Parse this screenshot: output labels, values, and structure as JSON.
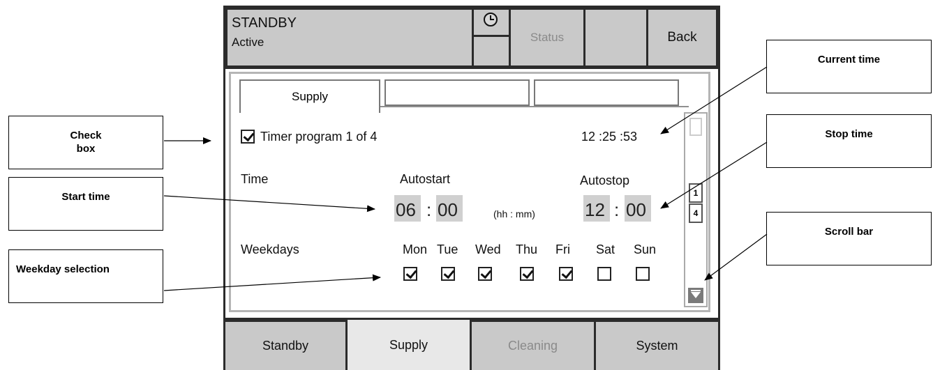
{
  "header": {
    "title": "STANDBY",
    "subtitle": "Active",
    "status_label": "Status",
    "back_label": "Back"
  },
  "tabs": [
    {
      "label": "Supply",
      "active": true
    },
    {
      "label": "",
      "active": false
    },
    {
      "label": "",
      "active": false
    }
  ],
  "content": {
    "timer_program_label": "Timer program 1 of 4",
    "timer_program_checked": true,
    "current_time": "12 :25 :53",
    "time_label": "Time",
    "autostart_label": "Autostart",
    "autostop_label": "Autostop",
    "start_hh": "06",
    "start_mm": "00",
    "stop_hh": "12",
    "stop_mm": "00",
    "colon": ":",
    "format_hint": "(hh : mm)",
    "weekdays_label": "Weekdays",
    "days": [
      {
        "label": "Mon",
        "checked": true
      },
      {
        "label": "Tue",
        "checked": true
      },
      {
        "label": "Wed",
        "checked": true
      },
      {
        "label": "Thu",
        "checked": true
      },
      {
        "label": "Fri",
        "checked": true
      },
      {
        "label": "Sat",
        "checked": false
      },
      {
        "label": "Sun",
        "checked": false
      }
    ]
  },
  "scrollbar": {
    "page_current": "1",
    "page_total": "4",
    "arrow_icon": "scroll-down-arrow-icon"
  },
  "footer_tabs": [
    {
      "label": "Standby",
      "state": "normal"
    },
    {
      "label": "Supply",
      "state": "active"
    },
    {
      "label": "Cleaning",
      "state": "disabled"
    },
    {
      "label": "System",
      "state": "normal"
    }
  ],
  "callouts": {
    "check_box": "Check box",
    "start_time": "Start time",
    "weekday_selection": "Weekday selection",
    "current_time": "Current time",
    "stop_time": "Stop time",
    "scroll_bar": "Scroll bar"
  },
  "colors": {
    "frame": "#2b2b2b",
    "button_bg": "#c9c9c9",
    "active_tab_bg": "#e8e8e8",
    "time_field_bg": "#d0d0d0",
    "disabled_text": "#8a8a8a"
  }
}
